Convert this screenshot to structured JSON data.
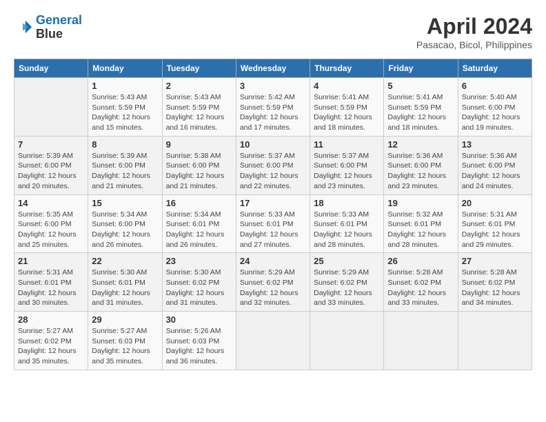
{
  "header": {
    "logo_line1": "General",
    "logo_line2": "Blue",
    "title": "April 2024",
    "subtitle": "Pasacao, Bicol, Philippines"
  },
  "weekdays": [
    "Sunday",
    "Monday",
    "Tuesday",
    "Wednesday",
    "Thursday",
    "Friday",
    "Saturday"
  ],
  "weeks": [
    [
      {
        "day": "",
        "info": ""
      },
      {
        "day": "1",
        "info": "Sunrise: 5:43 AM\nSunset: 5:59 PM\nDaylight: 12 hours\nand 15 minutes."
      },
      {
        "day": "2",
        "info": "Sunrise: 5:43 AM\nSunset: 5:59 PM\nDaylight: 12 hours\nand 16 minutes."
      },
      {
        "day": "3",
        "info": "Sunrise: 5:42 AM\nSunset: 5:59 PM\nDaylight: 12 hours\nand 17 minutes."
      },
      {
        "day": "4",
        "info": "Sunrise: 5:41 AM\nSunset: 5:59 PM\nDaylight: 12 hours\nand 18 minutes."
      },
      {
        "day": "5",
        "info": "Sunrise: 5:41 AM\nSunset: 5:59 PM\nDaylight: 12 hours\nand 18 minutes."
      },
      {
        "day": "6",
        "info": "Sunrise: 5:40 AM\nSunset: 6:00 PM\nDaylight: 12 hours\nand 19 minutes."
      }
    ],
    [
      {
        "day": "7",
        "info": "Sunrise: 5:39 AM\nSunset: 6:00 PM\nDaylight: 12 hours\nand 20 minutes."
      },
      {
        "day": "8",
        "info": "Sunrise: 5:39 AM\nSunset: 6:00 PM\nDaylight: 12 hours\nand 21 minutes."
      },
      {
        "day": "9",
        "info": "Sunrise: 5:38 AM\nSunset: 6:00 PM\nDaylight: 12 hours\nand 21 minutes."
      },
      {
        "day": "10",
        "info": "Sunrise: 5:37 AM\nSunset: 6:00 PM\nDaylight: 12 hours\nand 22 minutes."
      },
      {
        "day": "11",
        "info": "Sunrise: 5:37 AM\nSunset: 6:00 PM\nDaylight: 12 hours\nand 23 minutes."
      },
      {
        "day": "12",
        "info": "Sunrise: 5:36 AM\nSunset: 6:00 PM\nDaylight: 12 hours\nand 23 minutes."
      },
      {
        "day": "13",
        "info": "Sunrise: 5:36 AM\nSunset: 6:00 PM\nDaylight: 12 hours\nand 24 minutes."
      }
    ],
    [
      {
        "day": "14",
        "info": "Sunrise: 5:35 AM\nSunset: 6:00 PM\nDaylight: 12 hours\nand 25 minutes."
      },
      {
        "day": "15",
        "info": "Sunrise: 5:34 AM\nSunset: 6:00 PM\nDaylight: 12 hours\nand 26 minutes."
      },
      {
        "day": "16",
        "info": "Sunrise: 5:34 AM\nSunset: 6:01 PM\nDaylight: 12 hours\nand 26 minutes."
      },
      {
        "day": "17",
        "info": "Sunrise: 5:33 AM\nSunset: 6:01 PM\nDaylight: 12 hours\nand 27 minutes."
      },
      {
        "day": "18",
        "info": "Sunrise: 5:33 AM\nSunset: 6:01 PM\nDaylight: 12 hours\nand 28 minutes."
      },
      {
        "day": "19",
        "info": "Sunrise: 5:32 AM\nSunset: 6:01 PM\nDaylight: 12 hours\nand 28 minutes."
      },
      {
        "day": "20",
        "info": "Sunrise: 5:31 AM\nSunset: 6:01 PM\nDaylight: 12 hours\nand 29 minutes."
      }
    ],
    [
      {
        "day": "21",
        "info": "Sunrise: 5:31 AM\nSunset: 6:01 PM\nDaylight: 12 hours\nand 30 minutes."
      },
      {
        "day": "22",
        "info": "Sunrise: 5:30 AM\nSunset: 6:01 PM\nDaylight: 12 hours\nand 31 minutes."
      },
      {
        "day": "23",
        "info": "Sunrise: 5:30 AM\nSunset: 6:02 PM\nDaylight: 12 hours\nand 31 minutes."
      },
      {
        "day": "24",
        "info": "Sunrise: 5:29 AM\nSunset: 6:02 PM\nDaylight: 12 hours\nand 32 minutes."
      },
      {
        "day": "25",
        "info": "Sunrise: 5:29 AM\nSunset: 6:02 PM\nDaylight: 12 hours\nand 33 minutes."
      },
      {
        "day": "26",
        "info": "Sunrise: 5:28 AM\nSunset: 6:02 PM\nDaylight: 12 hours\nand 33 minutes."
      },
      {
        "day": "27",
        "info": "Sunrise: 5:28 AM\nSunset: 6:02 PM\nDaylight: 12 hours\nand 34 minutes."
      }
    ],
    [
      {
        "day": "28",
        "info": "Sunrise: 5:27 AM\nSunset: 6:02 PM\nDaylight: 12 hours\nand 35 minutes."
      },
      {
        "day": "29",
        "info": "Sunrise: 5:27 AM\nSunset: 6:03 PM\nDaylight: 12 hours\nand 35 minutes."
      },
      {
        "day": "30",
        "info": "Sunrise: 5:26 AM\nSunset: 6:03 PM\nDaylight: 12 hours\nand 36 minutes."
      },
      {
        "day": "",
        "info": ""
      },
      {
        "day": "",
        "info": ""
      },
      {
        "day": "",
        "info": ""
      },
      {
        "day": "",
        "info": ""
      }
    ]
  ]
}
